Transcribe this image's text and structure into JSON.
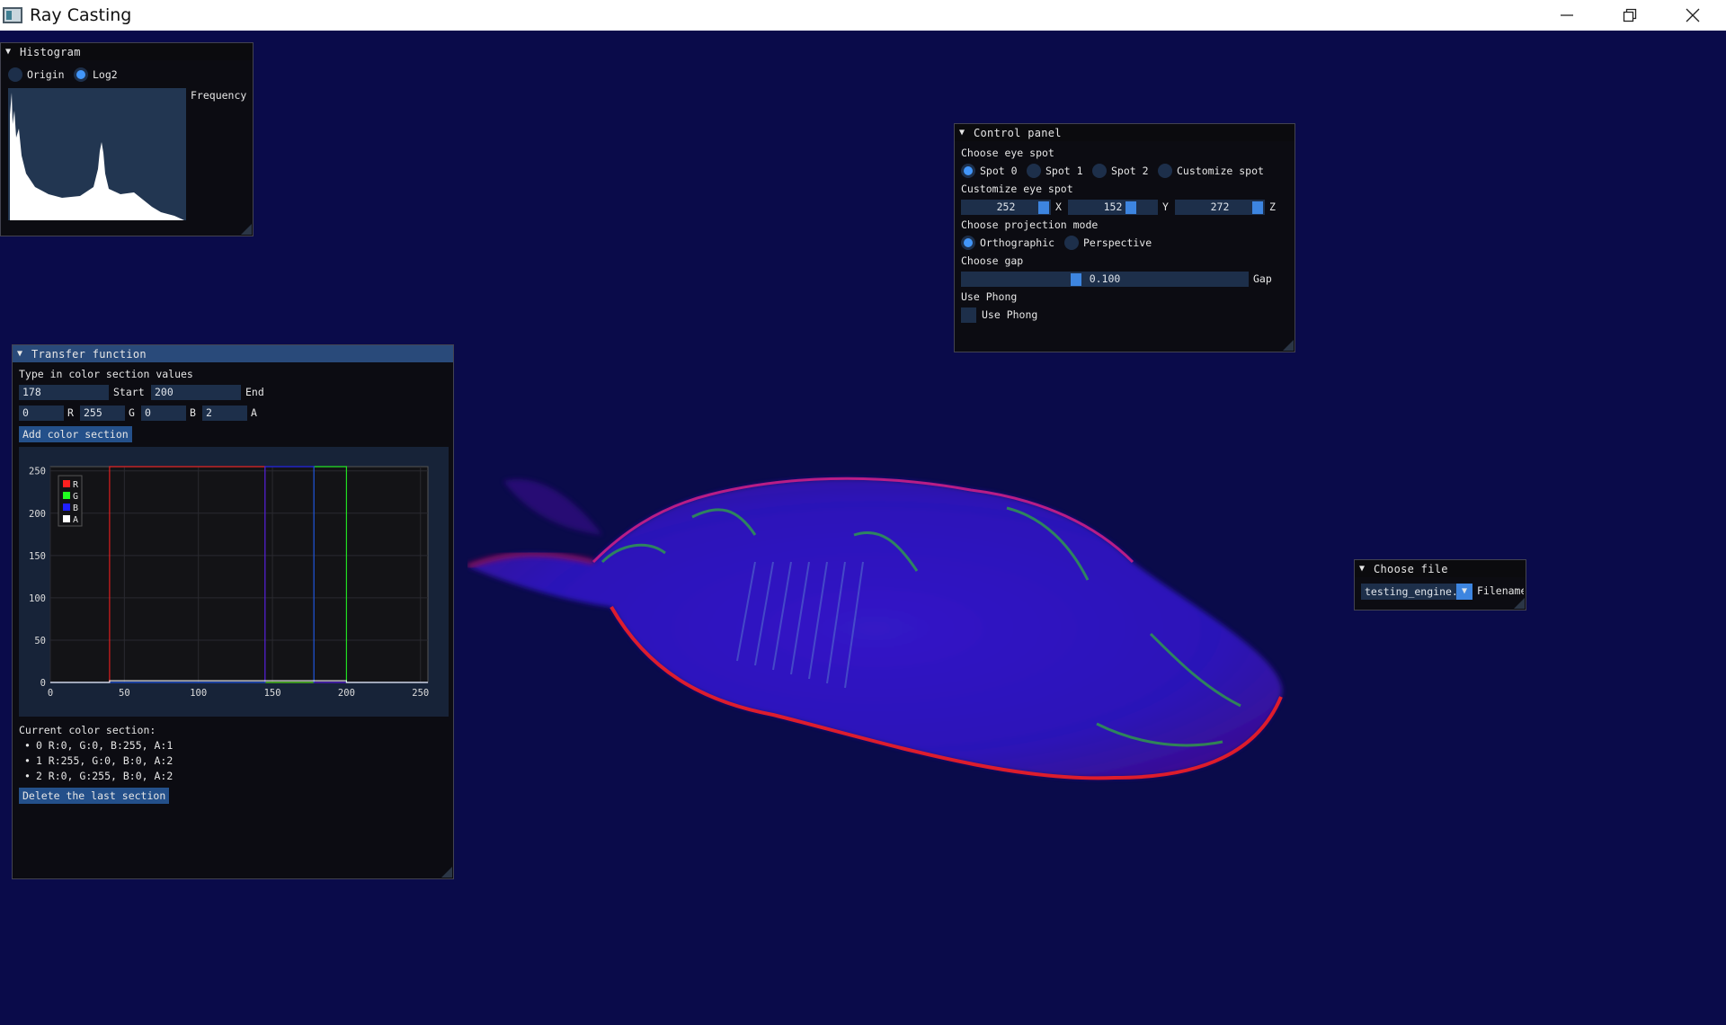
{
  "window": {
    "title": "Ray Casting"
  },
  "histogram": {
    "title": "Histogram",
    "mode_origin": "Origin",
    "mode_log2": "Log2",
    "selected_mode": "Log2",
    "frequency_label": "Frequency"
  },
  "control_panel": {
    "title": "Control panel",
    "eye_spot_heading": "Choose eye spot",
    "spots": [
      "Spot 0",
      "Spot 1",
      "Spot 2",
      "Customize spot"
    ],
    "selected_spot": "Spot 0",
    "customize_heading": "Customize eye spot",
    "x_value": "252",
    "x_label": "X",
    "y_value": "152",
    "y_label": "Y",
    "z_value": "272",
    "z_label": "Z",
    "x_level": 0.93,
    "y_level": 0.7,
    "z_level": 0.93,
    "projection_heading": "Choose projection mode",
    "projections": [
      "Orthographic",
      "Perspective"
    ],
    "selected_projection": "Orthographic",
    "gap_heading": "Choose gap",
    "gap_value": "0.100",
    "gap_label": "Gap",
    "gap_level": 0.38,
    "phong_heading": "Use Phong",
    "phong_label": "Use Phong",
    "phong_checked": false
  },
  "transfer_function": {
    "title": "Transfer function",
    "heading": "Type in color section values",
    "start_value": "178",
    "start_label": "Start",
    "end_value": "200",
    "end_label": "End",
    "r_value": "0",
    "r_label": "R",
    "g_value": "255",
    "g_label": "G",
    "b_value": "0",
    "b_label": "B",
    "a_value": "2",
    "a_label": "A",
    "add_button": "Add color section",
    "current_heading": "Current color section:",
    "sections": [
      "0  R:0, G:0, B:255, A:1",
      "1  R:255, G:0, B:0, A:2",
      "2  R:0, G:255, B:0, A:2"
    ],
    "delete_button": "Delete the last section"
  },
  "chart_data": {
    "type": "line",
    "xlim": [
      0,
      255
    ],
    "ylim": [
      0,
      255
    ],
    "x_ticks": [
      "0",
      "50",
      "100",
      "150",
      "200",
      "250"
    ],
    "y_ticks": [
      "0",
      "50",
      "100",
      "150",
      "200",
      "250"
    ],
    "legend": [
      "R",
      "G",
      "B",
      "A"
    ],
    "legend_position": "top-left",
    "grid": true,
    "series": [
      {
        "name": "R",
        "color": "#ff2020",
        "x": [
          0,
          40,
          40,
          145,
          145,
          255
        ],
        "y": [
          0,
          0,
          255,
          255,
          0,
          0
        ]
      },
      {
        "name": "G",
        "color": "#20ff20",
        "x": [
          0,
          178,
          178,
          200,
          200,
          255
        ],
        "y": [
          0,
          0,
          255,
          255,
          0,
          0
        ]
      },
      {
        "name": "B",
        "color": "#2020ff",
        "x": [
          0,
          145,
          145,
          178,
          178,
          255
        ],
        "y": [
          0,
          0,
          255,
          255,
          0,
          0
        ]
      },
      {
        "name": "A",
        "color": "#ffffff",
        "x": [
          0,
          40,
          40,
          200,
          200,
          255
        ],
        "y": [
          0,
          0,
          2,
          2,
          0,
          0
        ]
      }
    ]
  },
  "choose_file": {
    "title": "Choose file",
    "selected_file": "testing_engine.",
    "filename_label": "Filename"
  }
}
